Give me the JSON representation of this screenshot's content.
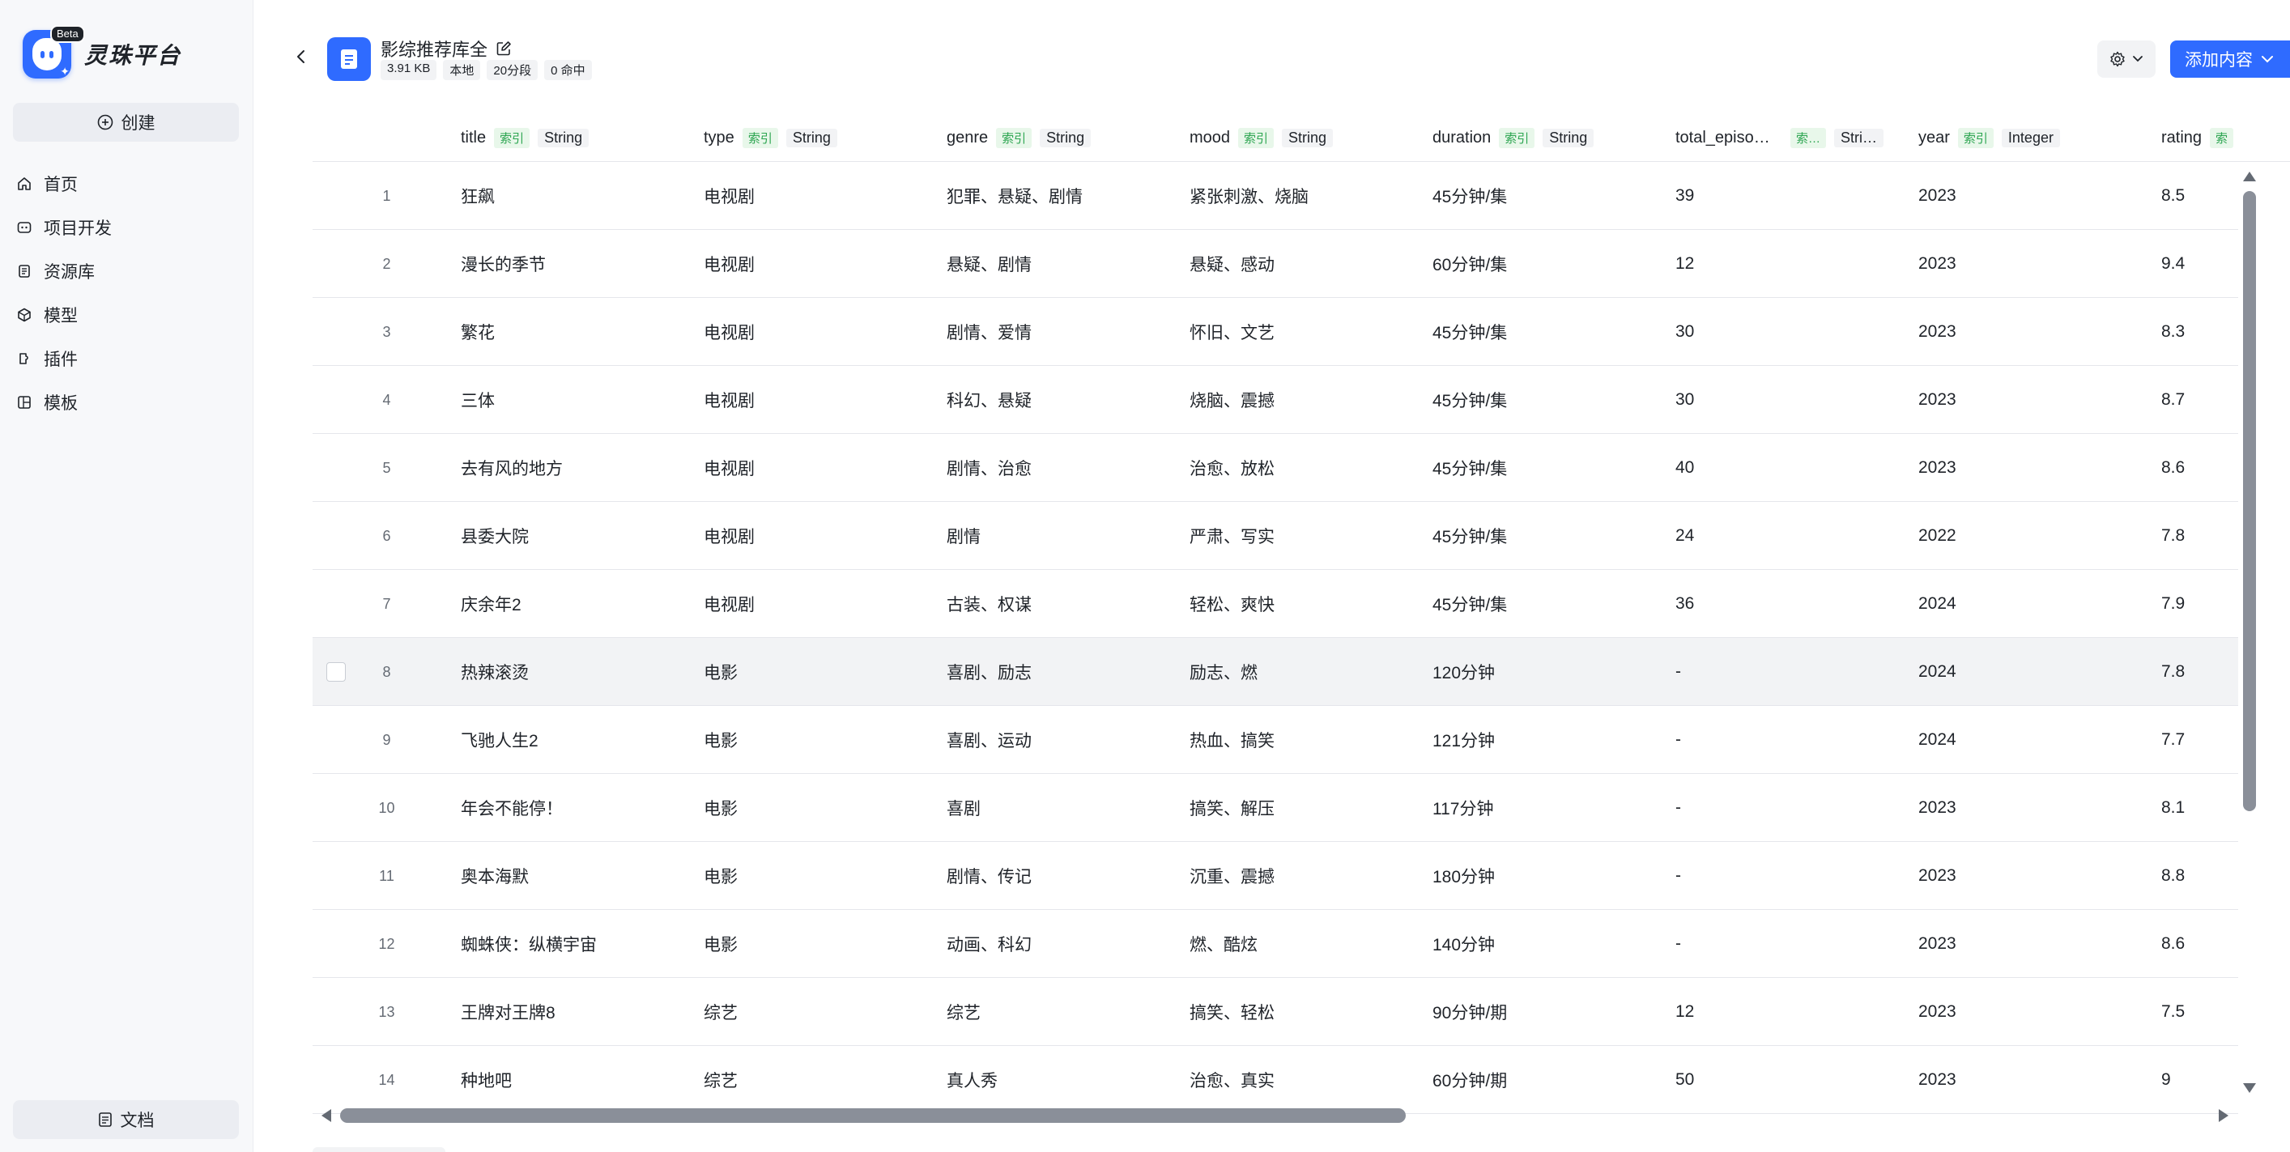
{
  "brand": {
    "name": "灵珠平台",
    "badge": "Beta"
  },
  "sidebar": {
    "create_label": "创建",
    "items": [
      {
        "label": "首页",
        "icon": "home-icon"
      },
      {
        "label": "项目开发",
        "icon": "project-icon"
      },
      {
        "label": "资源库",
        "icon": "library-icon"
      },
      {
        "label": "模型",
        "icon": "model-icon"
      },
      {
        "label": "插件",
        "icon": "plugin-icon"
      },
      {
        "label": "模板",
        "icon": "template-icon"
      }
    ],
    "docs_label": "文档"
  },
  "header": {
    "title": "影综推荐库全",
    "meta": [
      "3.91 KB",
      "本地",
      "20分段",
      "0 命中"
    ],
    "add_label": "添加内容"
  },
  "table": {
    "columns": [
      {
        "name": "title",
        "index": "索引",
        "type": "String"
      },
      {
        "name": "type",
        "index": "索引",
        "type": "String"
      },
      {
        "name": "genre",
        "index": "索引",
        "type": "String"
      },
      {
        "name": "mood",
        "index": "索引",
        "type": "String"
      },
      {
        "name": "duration",
        "index": "索引",
        "type": "String"
      },
      {
        "name": "total_episo…",
        "index": "索…",
        "type": "Stri…"
      },
      {
        "name": "year",
        "index": "索引",
        "type": "Integer"
      },
      {
        "name": "rating",
        "index": "索",
        "type": ""
      }
    ],
    "rows": [
      [
        "1",
        "狂飙",
        "电视剧",
        "犯罪、悬疑、剧情",
        "紧张刺激、烧脑",
        "45分钟/集",
        "39",
        "2023",
        "8.5"
      ],
      [
        "2",
        "漫长的季节",
        "电视剧",
        "悬疑、剧情",
        "悬疑、感动",
        "60分钟/集",
        "12",
        "2023",
        "9.4"
      ],
      [
        "3",
        "繁花",
        "电视剧",
        "剧情、爱情",
        "怀旧、文艺",
        "45分钟/集",
        "30",
        "2023",
        "8.3"
      ],
      [
        "4",
        "三体",
        "电视剧",
        "科幻、悬疑",
        "烧脑、震撼",
        "45分钟/集",
        "30",
        "2023",
        "8.7"
      ],
      [
        "5",
        "去有风的地方",
        "电视剧",
        "剧情、治愈",
        "治愈、放松",
        "45分钟/集",
        "40",
        "2023",
        "8.6"
      ],
      [
        "6",
        "县委大院",
        "电视剧",
        "剧情",
        "严肃、写实",
        "45分钟/集",
        "24",
        "2022",
        "7.8"
      ],
      [
        "7",
        "庆余年2",
        "电视剧",
        "古装、权谋",
        "轻松、爽快",
        "45分钟/集",
        "36",
        "2024",
        "7.9"
      ],
      [
        "8",
        "热辣滚烫",
        "电影",
        "喜剧、励志",
        "励志、燃",
        "120分钟",
        "-",
        "2024",
        "7.8"
      ],
      [
        "9",
        "飞驰人生2",
        "电影",
        "喜剧、运动",
        "热血、搞笑",
        "121分钟",
        "-",
        "2024",
        "7.7"
      ],
      [
        "10",
        "年会不能停！",
        "电影",
        "喜剧",
        "搞笑、解压",
        "117分钟",
        "-",
        "2023",
        "8.1"
      ],
      [
        "11",
        "奥本海默",
        "电影",
        "剧情、传记",
        "沉重、震撼",
        "180分钟",
        "-",
        "2023",
        "8.8"
      ],
      [
        "12",
        "蜘蛛侠：纵横宇宙",
        "电影",
        "动画、科幻",
        "燃、酷炫",
        "140分钟",
        "-",
        "2023",
        "8.6"
      ],
      [
        "13",
        "王牌对王牌8",
        "综艺",
        "综艺",
        "搞笑、轻松",
        "90分钟/期",
        "12",
        "2023",
        "7.5"
      ],
      [
        "14",
        "种地吧",
        "综艺",
        "真人秀",
        "治愈、真实",
        "60分钟/期",
        "50",
        "2023",
        "9"
      ]
    ],
    "hover_row": 7
  }
}
